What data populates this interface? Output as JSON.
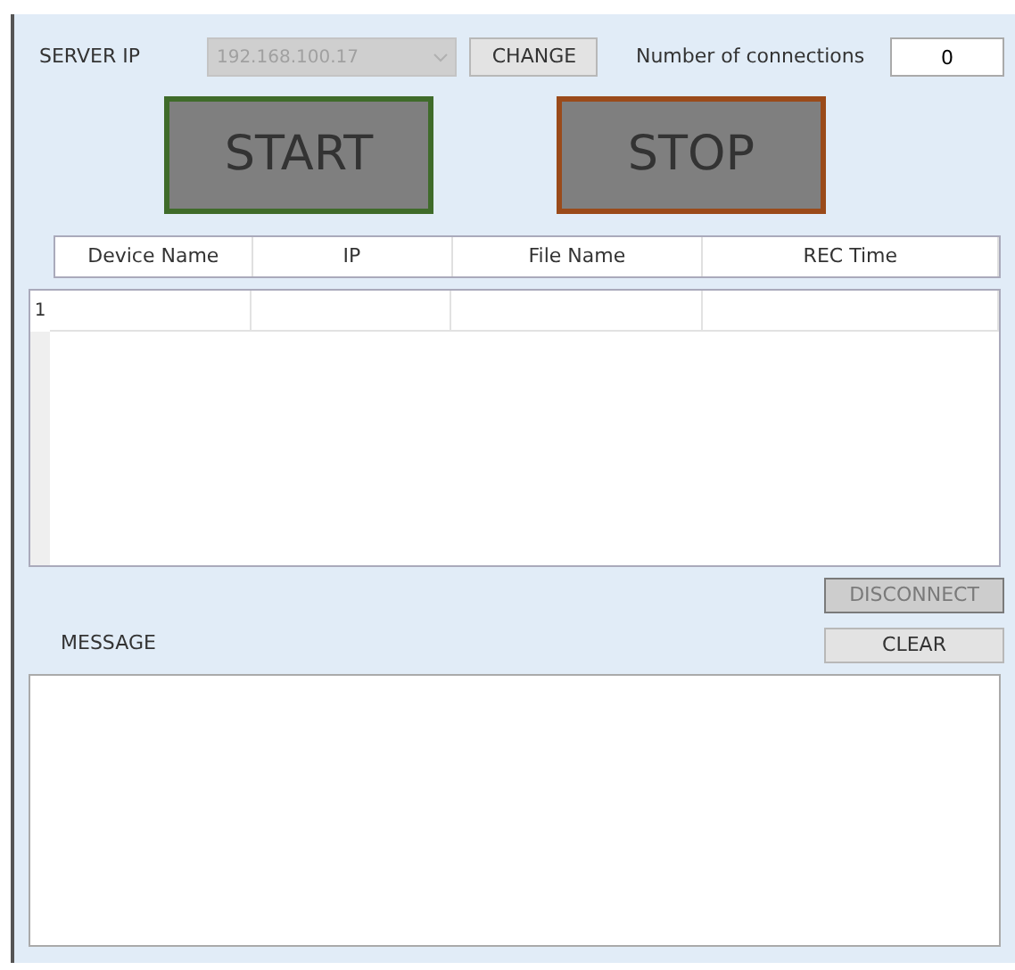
{
  "server_ip": {
    "label": "SERVER IP",
    "value": "192.168.100.17",
    "disabled": true
  },
  "change_button": {
    "label": "CHANGE"
  },
  "connections": {
    "label": "Number of connections",
    "value": "0"
  },
  "start_button": {
    "label": "START"
  },
  "stop_button": {
    "label": "STOP"
  },
  "table": {
    "columns": [
      "Device Name",
      "IP",
      "File Name",
      "REC Time"
    ],
    "rows": [
      {
        "number": "1"
      }
    ]
  },
  "disconnect_button": {
    "label": "DISCONNECT",
    "disabled": true
  },
  "message": {
    "label": "MESSAGE"
  },
  "clear_button": {
    "label": "CLEAR",
    "disabled": false
  }
}
